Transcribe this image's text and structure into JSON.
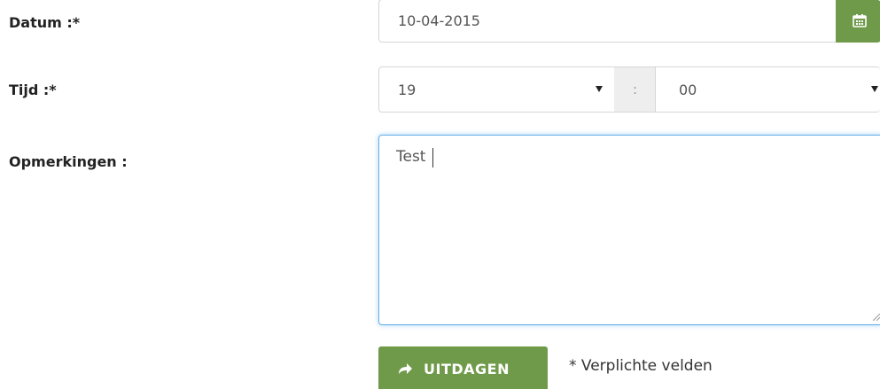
{
  "form": {
    "date": {
      "label": "Datum :*",
      "value": "10-04-2015",
      "calendar_icon": "calendar-icon"
    },
    "time": {
      "label": "Tijd :*",
      "hour": "19",
      "separator": ":",
      "minute": "00"
    },
    "remarks": {
      "label": "Opmerkingen :",
      "value": "Test"
    },
    "submit": {
      "label": "UITDAGEN",
      "icon": "share-arrow-icon"
    },
    "required_note": "* Verplichte velden"
  },
  "colors": {
    "accent_green": "#6f9a4a",
    "focus_blue": "#66afe9"
  }
}
